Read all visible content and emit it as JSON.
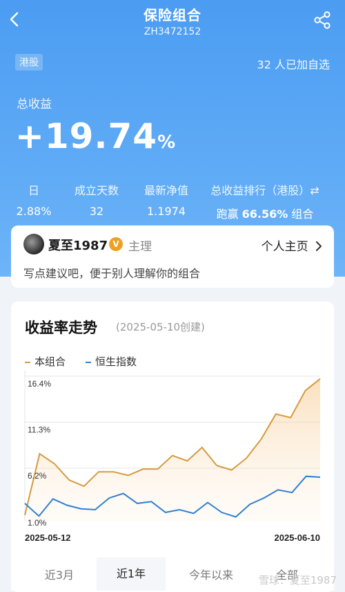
{
  "header": {
    "title": "保险组合",
    "code": "ZH3472152",
    "back_icon": "chevron-left-icon",
    "share_icon": "share-icon"
  },
  "tag": "港股",
  "watch_count": "32 人已加自选",
  "total_return": {
    "label": "总收益",
    "value": "+19.74",
    "unit": "%"
  },
  "stats": [
    {
      "label": "日",
      "value": "2.88%"
    },
    {
      "label": "成立天数",
      "value": "32"
    },
    {
      "label": "最新净值",
      "value": "1.1974"
    },
    {
      "label": "总收益排行（港股）⇄",
      "value_prefix": "跑赢 ",
      "value_bold": "66.56%",
      "value_suffix": " 组合"
    }
  ],
  "user": {
    "name": "夏至1987",
    "badge": "V",
    "role": "主理",
    "homepage_label": "个人主页",
    "hint": "写点建议吧，便于别人理解你的组合"
  },
  "chart_section": {
    "title": "收益率走势",
    "created": "(2025-05-10创建)"
  },
  "chart_data": {
    "type": "area",
    "series": [
      {
        "name": "本组合",
        "color": "#d69a3e",
        "values": [
          1.0,
          7.8,
          6.7,
          4.9,
          4.2,
          5.8,
          5.8,
          5.4,
          6.1,
          6.1,
          7.6,
          7.0,
          8.5,
          6.5,
          6.0,
          7.3,
          9.4,
          12.2,
          11.8,
          14.8,
          16.1
        ]
      },
      {
        "name": "恒生指数",
        "color": "#2f7fd1",
        "values": [
          2.3,
          0.9,
          2.8,
          2.1,
          1.7,
          1.6,
          2.9,
          3.4,
          2.3,
          2.5,
          1.3,
          1.6,
          1.2,
          2.4,
          1.3,
          0.8,
          2.2,
          2.9,
          3.8,
          3.5,
          5.3,
          5.2
        ]
      }
    ],
    "y_ticks": [
      "16.4%",
      "11.3%",
      "6.2%",
      "1.0%"
    ],
    "y_tick_values": [
      16.4,
      11.3,
      6.2,
      1.0
    ],
    "ylim": [
      0.3,
      17.0
    ],
    "x_labels": [
      "2025-05-12",
      "2025-06-10"
    ],
    "grid": true,
    "legend": "top-left"
  },
  "tabs": [
    {
      "label": "近3月",
      "active": false
    },
    {
      "label": "近1年",
      "active": true
    },
    {
      "label": "今年以来",
      "active": false
    },
    {
      "label": "全部",
      "active": false
    }
  ],
  "watermark": "雪球：夏至1987"
}
